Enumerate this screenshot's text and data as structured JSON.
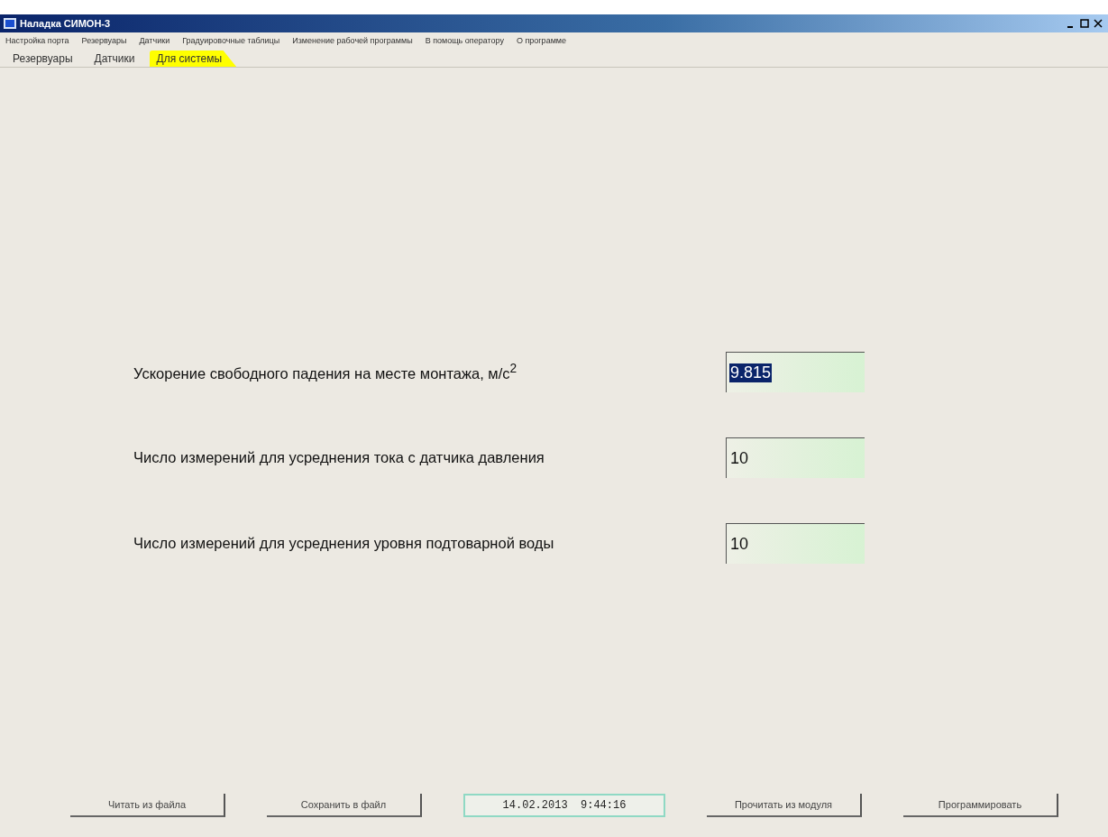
{
  "window": {
    "title": "Наладка СИМОН-3"
  },
  "menu": [
    "Настройка порта",
    "Резервуары",
    "Датчики",
    "Градуировочные таблицы",
    "Изменение рабочей программы",
    "В помощь оператору",
    "О программе"
  ],
  "tabs": [
    {
      "label": "Резервуары",
      "selected": false
    },
    {
      "label": "Датчики",
      "selected": false
    },
    {
      "label": "Для системы",
      "selected": true
    }
  ],
  "fields": [
    {
      "label": "Ускорение свободного падения на месте монтажа, м/с$^{2}$",
      "value": "9.815",
      "selected": true
    },
    {
      "label": "Число измерений для усреднения тока с датчика давления",
      "value": "10",
      "selected": false
    },
    {
      "label": "Число измерений для усреднения уровня подтоварной воды",
      "value": "10",
      "selected": false
    }
  ],
  "bottom_bar": [
    {
      "kind": "button",
      "label": "Читать из файла"
    },
    {
      "kind": "button",
      "label": "Сохранить в файл"
    },
    {
      "kind": "datetime",
      "label": "14.02.2013  9:44:16"
    },
    {
      "kind": "button",
      "label": "Прочитать из модуля"
    },
    {
      "kind": "button",
      "label": "Программировать"
    }
  ]
}
